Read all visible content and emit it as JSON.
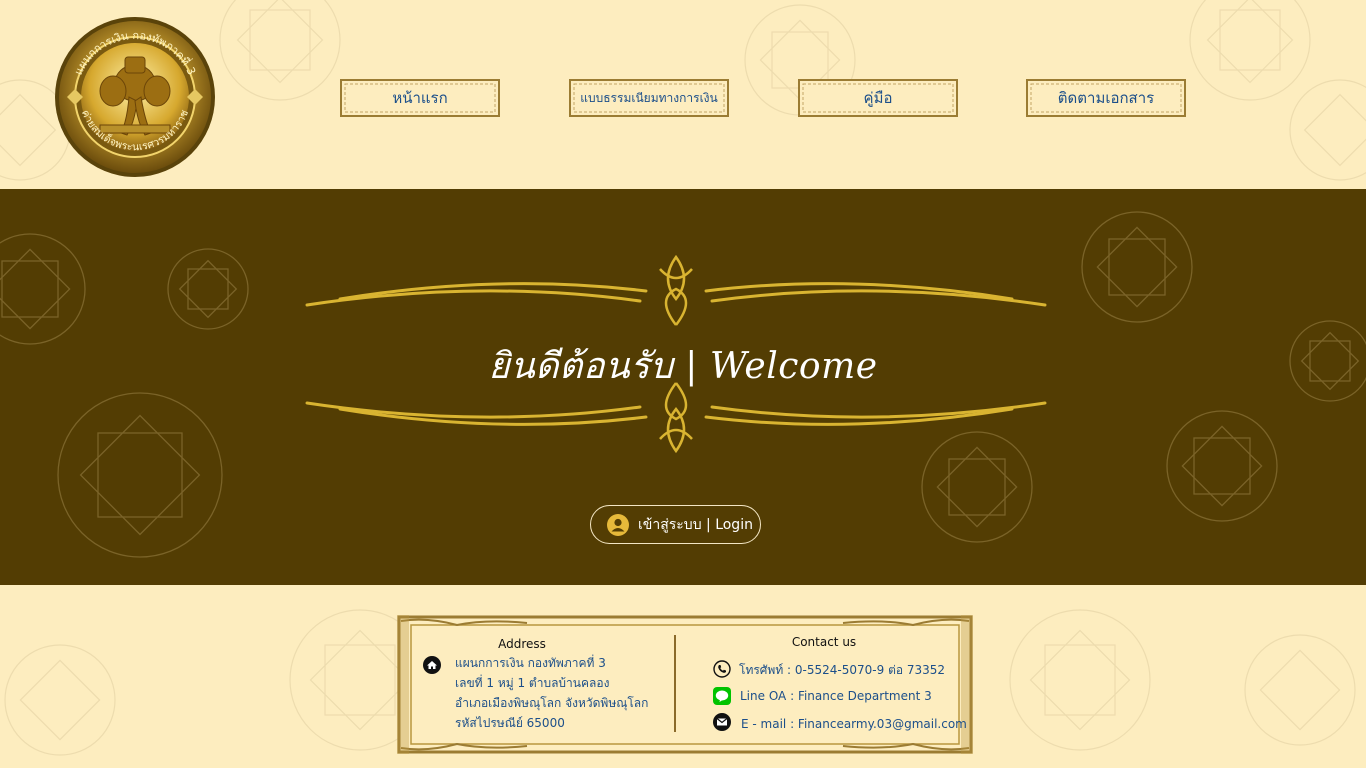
{
  "nav": {
    "items": [
      {
        "label": "หน้าแรก"
      },
      {
        "label": "แบบธรรมเนียมทางการเงิน"
      },
      {
        "label": "คู่มือ"
      },
      {
        "label": "ติดตามเอกสาร"
      }
    ]
  },
  "logo": {
    "ring_text_top": "แผนกการเงิน กองทัพภาคที่ 3",
    "ring_text_bottom": "ค่ายสมเด็จพระนเรศวรมหาราช",
    "icon": "elephant-emblem"
  },
  "hero": {
    "welcome": "ยินดีต้อนรับ | Welcome",
    "login_label": "เข้าสู่ระบบ | Login",
    "login_icon": "user-icon"
  },
  "footer": {
    "address_title": "Address",
    "address_lines": [
      "แผนกการเงิน กองทัพภาคที่ 3",
      "เลขที่ 1 หมู่ 1 ตำบลบ้านคลอง",
      "อำเภอเมืองพิษณุโลก จังหวัดพิษณุโลก",
      "รหัสไปรษณีย์ 65000"
    ],
    "contact_title": "Contact us",
    "phone": "โทรศัพท์ : 0-5524-5070-9 ต่อ 73352",
    "line": "Line OA : Finance Department 3",
    "email": "E - mail : Financearmy.03@gmail.com"
  },
  "colors": {
    "page_bg": "#fdedbf",
    "hero_bg": "#533d03",
    "gold": "#d9b431",
    "link_blue": "#1c4f8a",
    "line_green": "#00c300"
  }
}
